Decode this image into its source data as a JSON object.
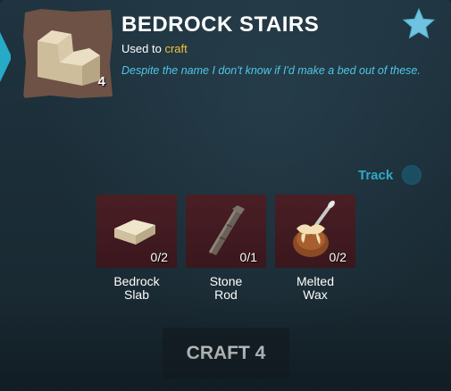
{
  "item": {
    "title": "BEDROCK STAIRS",
    "used_to_prefix": "Used to",
    "used_to_keyword": "craft",
    "description": "Despite the name I don't know if I'd make a bed out of these.",
    "count": "4",
    "icon": "bedrock-stairs-icon"
  },
  "favorite_icon": "star-icon",
  "track": {
    "label": "Track"
  },
  "ingredients": [
    {
      "name_line1": "Bedrock",
      "name_line2": "Slab",
      "quantity": "0/2",
      "icon": "bedrock-slab-icon"
    },
    {
      "name_line1": "Stone",
      "name_line2": "Rod",
      "quantity": "0/1",
      "icon": "stone-rod-icon"
    },
    {
      "name_line1": "Melted",
      "name_line2": "Wax",
      "quantity": "0/2",
      "icon": "melted-wax-icon"
    }
  ],
  "craft_button": {
    "label": "CRAFT 4"
  },
  "colors": {
    "panel_bg": "#1f3440",
    "accent_cyan": "#27a9c8",
    "description_text": "#4fc7e6",
    "keyword_gold": "#f0c23a",
    "ingredient_bg": "#4a1e25",
    "icon_frame": "#6e5245"
  }
}
